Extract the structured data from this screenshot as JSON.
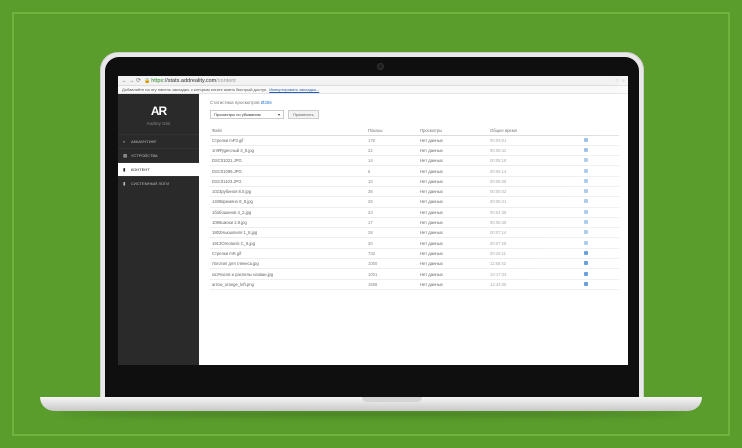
{
  "browser": {
    "https": "https",
    "host": "://stats.addreality.com",
    "path": "/content"
  },
  "bookmark_bar": {
    "text": "Добавляйте на эту панель закладки, к которым хотите иметь быстрый доступ.",
    "link": "Импортировать закладки..."
  },
  "sidebar": {
    "user_name": "Andrey Gim",
    "items": [
      {
        "label": "АККАУНТИНГ",
        "icon": "chart-icon",
        "active": false
      },
      {
        "label": "УСТРОЙСТВА",
        "icon": "devices-icon",
        "active": false
      },
      {
        "label": "КОНТЕНТ",
        "icon": "content-icon",
        "active": true
      },
      {
        "label": "СИСТЕМНЫЙ ЛОГИ",
        "icon": "log-icon",
        "active": false
      }
    ]
  },
  "main": {
    "subtitle": "Статистика просмотров",
    "subtitle_link": "Ø356",
    "filter_select": "Просмотры по убыванию",
    "apply_button": "Применить",
    "columns": [
      "Файл",
      "Показы",
      "Просмотры",
      "Общее время"
    ],
    "rows": [
      {
        "file": "Cтрелки mР3.gif",
        "views": "178",
        "status": "Нет данных",
        "time": "00:03:01",
        "light": true
      },
      {
        "file": "1пФРдресный 3_8.jpg",
        "views": "22",
        "status": "Нет данных",
        "time": "00:05:42",
        "light": true
      },
      {
        "file": "DSC01021.JPG",
        "views": "14",
        "status": "Нет данных",
        "time": "00:05:18",
        "light": true
      },
      {
        "file": "DSC01095.JPG",
        "views": "6",
        "status": "Нет данных",
        "time": "00:05:14",
        "light": true
      },
      {
        "file": "DSC01103.JPG",
        "views": "10",
        "status": "Нет данных",
        "time": "00:05:06",
        "light": true
      },
      {
        "file": "1023рубиноя 8.0.jpg",
        "views": "36",
        "status": "Нет данных",
        "time": "00:05:02",
        "light": true
      },
      {
        "file": "1409времяно 8_8.jpg",
        "views": "26",
        "status": "Нет данных",
        "time": "00:05:41",
        "light": true
      },
      {
        "file": "1бобошинов 4_2.jpg",
        "views": "23",
        "status": "Нет данных",
        "time": "00:04:38",
        "light": true
      },
      {
        "file": "1069шкоки 2.8.jpg",
        "views": "17",
        "status": "Нет данных",
        "time": "00:05:38",
        "light": true
      },
      {
        "file": "1802Ньюшпиля 1_8.jpg",
        "views": "28",
        "status": "Нет данных",
        "time": "00:07:14",
        "light": true
      },
      {
        "file": "1913Ornotanis C_8.jpg",
        "views": "20",
        "status": "Нет данных",
        "time": "00:07:26",
        "light": true
      },
      {
        "file": "Стрелки mR.gif",
        "views": "732",
        "status": "Нет данных",
        "time": "00:29:11",
        "light": false
      },
      {
        "file": "Логотип для глянеса.jpg",
        "views": "1000",
        "status": "Нет данных",
        "time": "11:56:42",
        "light": false
      },
      {
        "file": "коЗЧасов и распилы назван.jpg",
        "views": "1001",
        "status": "Нет данных",
        "time": "10:17:33",
        "light": false
      },
      {
        "file": "arrow_orange_left.png",
        "views": "1688",
        "status": "Нет данных",
        "time": "12:43:30",
        "light": false
      }
    ]
  }
}
